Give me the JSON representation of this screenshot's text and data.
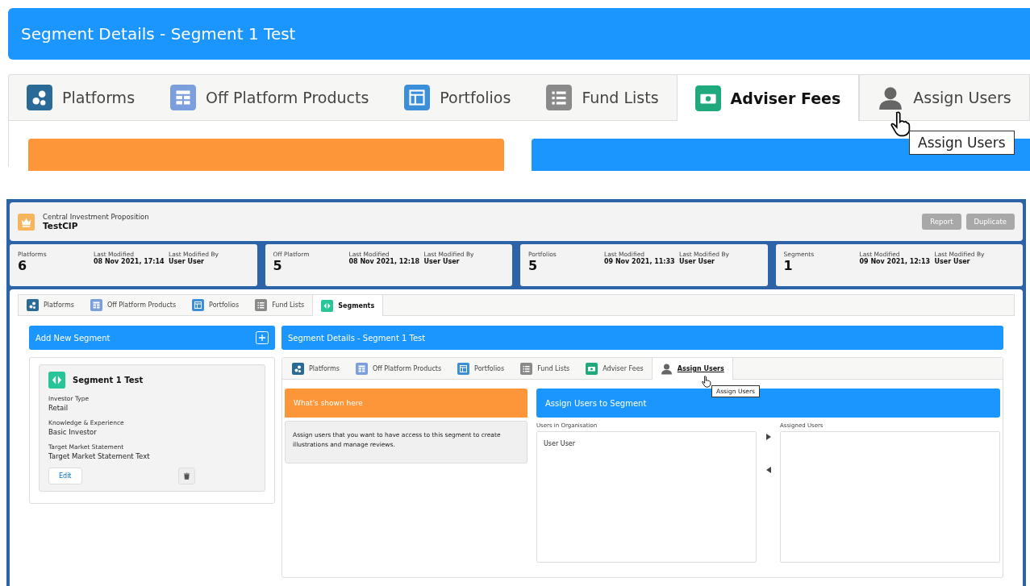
{
  "zoomed_view": {
    "title": "Segment Details - Segment 1 Test",
    "tabs": [
      {
        "label": "Platforms",
        "kind": "platforms",
        "selected": false
      },
      {
        "label": "Off Platform Products",
        "kind": "products",
        "selected": false
      },
      {
        "label": "Portfolios",
        "kind": "portfolios",
        "selected": false
      },
      {
        "label": "Fund Lists",
        "kind": "lists",
        "selected": false
      },
      {
        "label": "Adviser Fees",
        "kind": "fees",
        "selected": true
      },
      {
        "label": "Assign Users",
        "kind": "users",
        "selected": false
      }
    ],
    "tooltip": "Assign Users"
  },
  "app_header": {
    "subtitle": "Central Investment Proposition",
    "title": "TestCIP",
    "buttons": [
      {
        "label": "Report",
        "disabled": true
      },
      {
        "label": "Duplicate",
        "disabled": true
      }
    ]
  },
  "stats": [
    {
      "label": "Platforms",
      "value": "6",
      "modified_label": "Last Modified",
      "modified": "08 Nov 2021, 17:14",
      "by_label": "Last Modified By",
      "by": "User User"
    },
    {
      "label": "Off Platform",
      "value": "5",
      "modified_label": "Last Modified",
      "modified": "08 Nov 2021, 12:18",
      "by_label": "Last Modified By",
      "by": "User User"
    },
    {
      "label": "Portfolios",
      "value": "5",
      "modified_label": "Last Modified",
      "modified": "09 Nov 2021, 11:33",
      "by_label": "Last Modified By",
      "by": "User User"
    },
    {
      "label": "Segments",
      "value": "1",
      "modified_label": "Last Modified",
      "modified": "09 Nov 2021, 12:13",
      "by_label": "Last Modified By",
      "by": "User User"
    }
  ],
  "main_tabs": [
    {
      "label": "Platforms",
      "kind": "platforms",
      "selected": false
    },
    {
      "label": "Off Platform Products",
      "kind": "products",
      "selected": false
    },
    {
      "label": "Portfolios",
      "kind": "portfolios",
      "selected": false
    },
    {
      "label": "Fund Lists",
      "kind": "lists",
      "selected": false
    },
    {
      "label": "Segments",
      "kind": "segments",
      "selected": true
    }
  ],
  "left_panel": {
    "title": "Add New Segment",
    "segment": {
      "name": "Segment 1 Test",
      "fields": [
        {
          "label": "Investor Type",
          "value": "Retail"
        },
        {
          "label": "Knowledge & Experience",
          "value": "Basic Investor"
        },
        {
          "label": "Target Market Statement",
          "value": "Target Market Statement Text"
        }
      ],
      "edit_button": "Edit"
    }
  },
  "right_panel": {
    "title": "Segment Details - Segment 1 Test",
    "tabs": [
      {
        "label": "Platforms",
        "kind": "platforms",
        "selected": false
      },
      {
        "label": "Off Platform Products",
        "kind": "products",
        "selected": false
      },
      {
        "label": "Portfolios",
        "kind": "portfolios",
        "selected": false
      },
      {
        "label": "Fund Lists",
        "kind": "lists",
        "selected": false
      },
      {
        "label": "Adviser Fees",
        "kind": "fees",
        "selected": false
      },
      {
        "label": "Assign Users",
        "kind": "users",
        "selected": true
      }
    ],
    "tooltip": "Assign Users",
    "info_title": "What's shown here",
    "info_text": "Assign users that you want to have access to this segment to create illustrations and manage reviews.",
    "assign_title": "Assign Users to Segment",
    "available_label": "Users in Organisation",
    "available_users": [
      "User User"
    ],
    "assigned_label": "Assigned Users"
  }
}
